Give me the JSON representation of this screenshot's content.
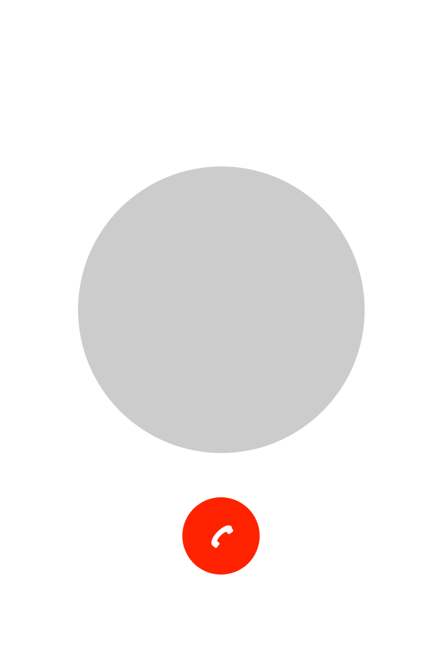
{
  "call_screen": {
    "background_color": "#ffffff",
    "avatar": {
      "color": "#cccccc"
    },
    "end_call_button": {
      "color": "#ff2200",
      "icon": "phone-hangup-icon",
      "icon_color": "#ffffff"
    }
  }
}
